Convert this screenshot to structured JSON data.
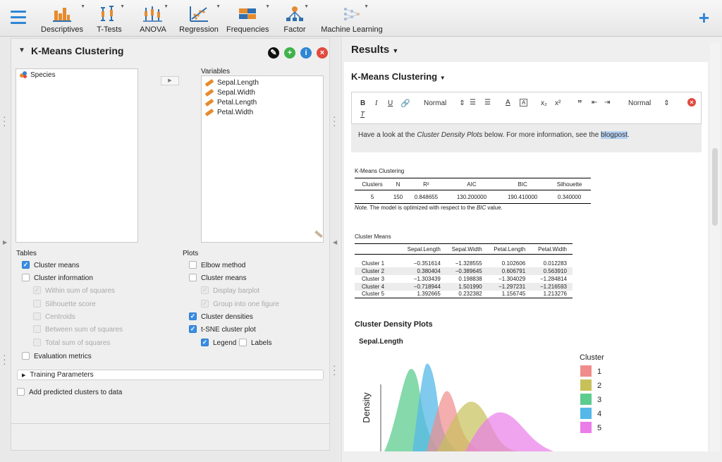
{
  "toolbar": {
    "tools": [
      {
        "label": "Descriptives",
        "icon": "descriptives-icon"
      },
      {
        "label": "T-Tests",
        "icon": "ttests-icon"
      },
      {
        "label": "ANOVA",
        "icon": "anova-icon"
      },
      {
        "label": "Regression",
        "icon": "regression-icon"
      },
      {
        "label": "Frequencies",
        "icon": "frequencies-icon"
      },
      {
        "label": "Factor",
        "icon": "factor-icon"
      },
      {
        "label": "Machine Learning",
        "icon": "machine-learning-icon"
      }
    ],
    "plus": "+"
  },
  "analysis": {
    "title": "K-Means Clustering",
    "source_variables": [
      "Species"
    ],
    "variables_label": "Variables",
    "variables": [
      "Sepal.Length",
      "Sepal.Width",
      "Petal.Length",
      "Petal.Width"
    ],
    "tables_label": "Tables",
    "plots_label": "Plots",
    "tables_options": [
      {
        "label": "Cluster means",
        "checked": true,
        "disabled": false
      },
      {
        "label": "Cluster information",
        "checked": false,
        "disabled": false
      },
      {
        "label": "Within sum of squares",
        "checked": true,
        "disabled": true
      },
      {
        "label": "Silhouette score",
        "checked": false,
        "disabled": true
      },
      {
        "label": "Centroids",
        "checked": false,
        "disabled": true
      },
      {
        "label": "Between sum of squares",
        "checked": false,
        "disabled": true
      },
      {
        "label": "Total sum of squares",
        "checked": false,
        "disabled": true
      },
      {
        "label": "Evaluation metrics",
        "checked": false,
        "disabled": false
      }
    ],
    "plots_options": [
      {
        "label": "Elbow method",
        "checked": false,
        "disabled": false
      },
      {
        "label": "Cluster means",
        "checked": false,
        "disabled": false
      },
      {
        "label": "Display barplot",
        "checked": true,
        "disabled": true
      },
      {
        "label": "Group into one figure",
        "checked": true,
        "disabled": true
      },
      {
        "label": "Cluster densities",
        "checked": true,
        "disabled": false
      },
      {
        "label": "t-SNE cluster plot",
        "checked": true,
        "disabled": false
      }
    ],
    "legend_label": "Legend",
    "labels_label": "Labels",
    "training_parameters": "Training Parameters",
    "add_predicted": "Add predicted clusters to data"
  },
  "results": {
    "title": "Results",
    "section_title": "K-Means Clustering",
    "editor": {
      "style1": "Normal",
      "style2": "Normal",
      "text_before": "Have a look at the ",
      "text_italic": "Cluster Density Plots",
      "text_middle": " below. For more information, see the ",
      "text_link": "blogpost",
      "text_end": "."
    },
    "main_table": {
      "caption": "K-Means Clustering",
      "headers": [
        "Clusters",
        "N",
        "R²",
        "AIC",
        "BIC",
        "Silhouette"
      ],
      "row": [
        "5",
        "150",
        "0.848655",
        "130.200000",
        "190.410000",
        "0.340000"
      ],
      "note_label": "Note.",
      "note_text1": " The model is optimized with respect to the ",
      "note_italic": "BIC",
      "note_text2": " value."
    },
    "means_table": {
      "caption": "Cluster Means",
      "headers": [
        "",
        "Sepal.Length",
        "Sepal.Width",
        "Petal.Length",
        "Petal.Width"
      ],
      "rows": [
        [
          "Cluster 1",
          "−0.351614",
          "−1.328555",
          "0.102606",
          "0.012283"
        ],
        [
          "Cluster 2",
          "0.380404",
          "−0.389645",
          "0.606791",
          "0.563910"
        ],
        [
          "Cluster 3",
          "−1.303439",
          "0.198838",
          "−1.304029",
          "−1.284814"
        ],
        [
          "Cluster 4",
          "−0.718944",
          "1.501990",
          "−1.297231",
          "−1.216593"
        ],
        [
          "Cluster 5",
          "1.392665",
          "0.232382",
          "1.156745",
          "1.213276"
        ]
      ]
    },
    "density_title": "Cluster Density Plots",
    "density_subtitle": "Sepal.Length",
    "density_ylabel": "Density",
    "legend_title": "Cluster",
    "legend": [
      {
        "label": "1",
        "color": "#f08c8c"
      },
      {
        "label": "2",
        "color": "#c8c15a"
      },
      {
        "label": "3",
        "color": "#5ccc8f"
      },
      {
        "label": "4",
        "color": "#55b8e8"
      },
      {
        "label": "5",
        "color": "#ea7de8"
      }
    ]
  }
}
